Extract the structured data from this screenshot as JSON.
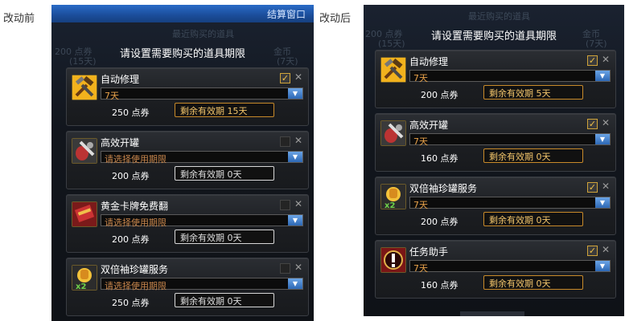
{
  "captions": {
    "before": "改动前",
    "after": "改动后"
  },
  "window": {
    "close_label": "结算窗口"
  },
  "ghost_text": {
    "top_title": "最近购买的道具",
    "price_col": "200 点券",
    "days_col": "(15天)",
    "gold_col": "金币",
    "days_col2": "(7天)"
  },
  "dialog": {
    "title": "请设置需要购买的道具期限"
  },
  "before": {
    "items": [
      {
        "name": "自动修理",
        "icon": "hammer-wrench-icon",
        "checked": true,
        "select": "7天",
        "select_placeholder": false,
        "price": "250 点券",
        "remain": "剩余有效期 15天",
        "remain_zero": false
      },
      {
        "name": "高效开罐",
        "icon": "can-opener-icon",
        "checked": false,
        "select": "请选择使用期限",
        "select_placeholder": true,
        "price": "200 点券",
        "remain": "剩余有效期 0天",
        "remain_zero": true
      },
      {
        "name": "黄金卡牌免费翻",
        "icon": "gold-card-icon",
        "checked": false,
        "select": "请选择使用期限",
        "select_placeholder": true,
        "price": "200 点券",
        "remain": "剩余有效期 0天",
        "remain_zero": true
      },
      {
        "name": "双倍袖珍罐服务",
        "icon": "double-can-icon",
        "checked": false,
        "select": "请选择使用期限",
        "select_placeholder": true,
        "price": "250 点券",
        "remain": "剩余有效期 0天",
        "remain_zero": true
      }
    ]
  },
  "after": {
    "items": [
      {
        "name": "自动修理",
        "icon": "hammer-wrench-icon",
        "checked": true,
        "select": "7天",
        "select_placeholder": false,
        "price": "200 点券",
        "remain": "剩余有效期 5天",
        "remain_zero": false
      },
      {
        "name": "高效开罐",
        "icon": "can-opener-icon",
        "checked": true,
        "select": "7天",
        "select_placeholder": false,
        "price": "160 点券",
        "remain": "剩余有效期 0天",
        "remain_zero": false
      },
      {
        "name": "双倍袖珍罐服务",
        "icon": "double-can-icon",
        "checked": true,
        "select": "7天",
        "select_placeholder": false,
        "price": "200 点券",
        "remain": "剩余有效期 0天",
        "remain_zero": false
      },
      {
        "name": "任务助手",
        "icon": "mission-helper-icon",
        "checked": true,
        "select": "7天",
        "select_placeholder": false,
        "price": "160 点券",
        "remain": "剩余有效期 0天",
        "remain_zero": false
      }
    ]
  },
  "colors": {
    "panel_bg": "#12161d",
    "card_bg": "#1c1e22",
    "accent_gold": "#f3c56b",
    "select_text": "#e8a24a",
    "topbar_blue": "#1b4d9a"
  }
}
